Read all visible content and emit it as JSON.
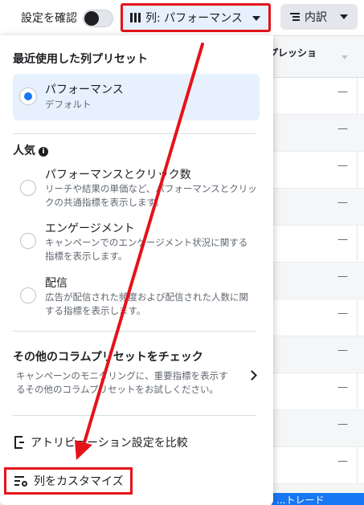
{
  "topbar": {
    "settings_label": "設定を確認",
    "columns_button_label": "列: パフォーマンス",
    "breakdown_button_label": "内訳"
  },
  "background_table": {
    "header_fragment": "プレッショ",
    "row_values": [
      "—",
      "—",
      "—",
      "—",
      "—",
      "—",
      "—",
      "—",
      "—",
      "—",
      "—",
      "—"
    ],
    "blue_button_fragment": "...トレード"
  },
  "panel": {
    "recent_title": "最近使用した列プリセット",
    "recent_preset": {
      "label": "パフォーマンス",
      "sublabel": "デフォルト"
    },
    "popular_title": "人気",
    "popular_items": [
      {
        "label": "パフォーマンスとクリック数",
        "desc_line1": "リーチや結果の単価など、パフォーマンスとクリッ",
        "desc_line2": "クの共通指標を表示します。"
      },
      {
        "label": "エンゲージメント",
        "desc_line1": "キャンペーンでのエンゲージメント状況に関する",
        "desc_line2": "指標を表示します。"
      },
      {
        "label": "配信",
        "desc_line1": "広告が配信された頻度および配信された人数に関",
        "desc_line2": "する指標を表示します。"
      }
    ],
    "other_presets": {
      "title": "その他のコラムプリセットをチェック",
      "desc_line1": "キャンペーンのモニタリングに、重要指標を表示す",
      "desc_line2": "るその他のコラムプリセットをお試しください。"
    },
    "attribution_label": "アトリビューション設定を比較",
    "customize_label": "列をカスタマイズ"
  },
  "colors": {
    "annotation_red": "#e4131a",
    "selected_bg": "#e7f0fd",
    "radio_blue": "#1877f2"
  }
}
